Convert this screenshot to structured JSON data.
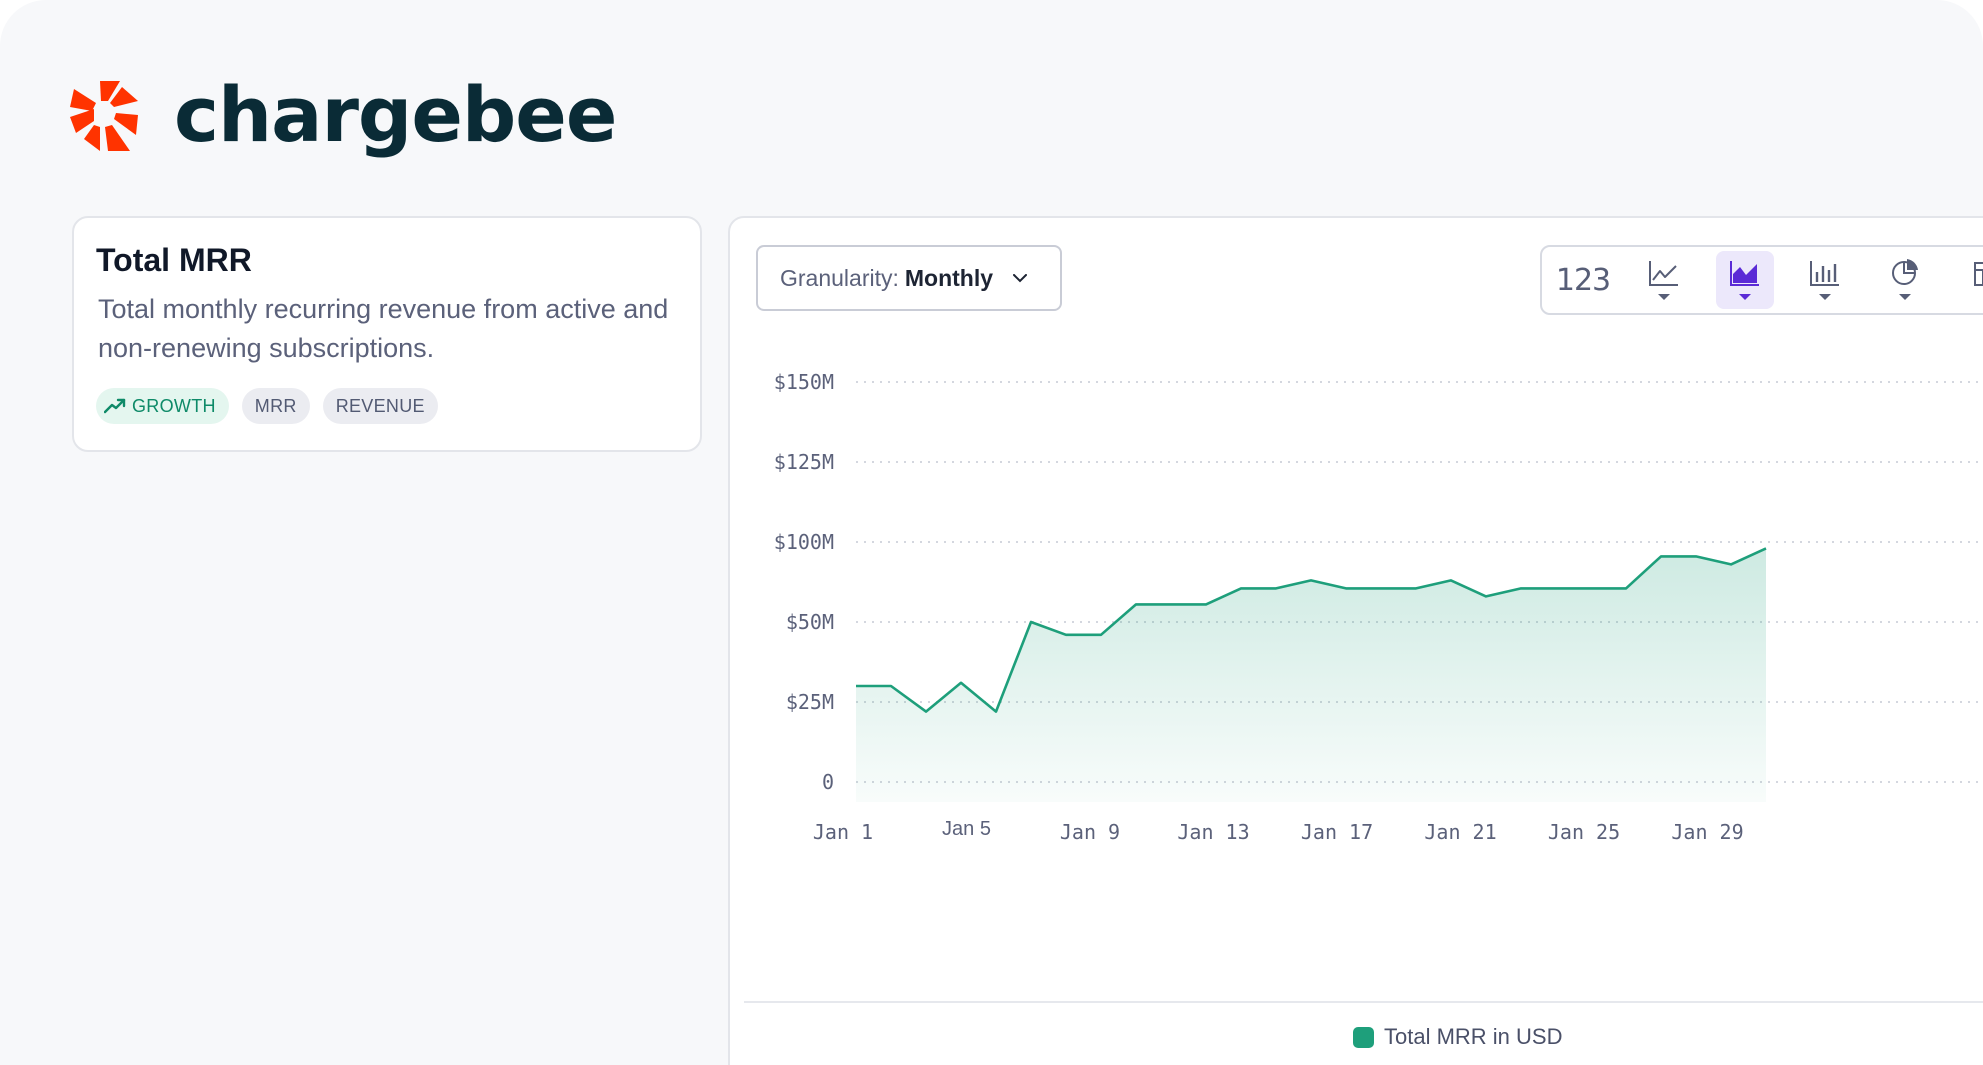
{
  "brand": {
    "name": "chargebee",
    "logo_color": "#ff3300",
    "text_color": "#0a2b36"
  },
  "metric_card": {
    "title": "Total MRR",
    "description": "Total monthly recurring revenue from active and non-renewing subscriptions.",
    "tags": [
      {
        "label": "GROWTH",
        "icon": "trend-up-icon"
      },
      {
        "label": "MRR"
      },
      {
        "label": "REVENUE"
      }
    ]
  },
  "controls": {
    "granularity_label": "Granularity:",
    "granularity_value": "Monthly",
    "toolbar": [
      {
        "name": "number-view",
        "label": "123"
      },
      {
        "name": "line-chart",
        "icon": "line-chart-icon"
      },
      {
        "name": "area-chart",
        "icon": "area-chart-icon",
        "active": true
      },
      {
        "name": "bar-chart",
        "icon": "bar-chart-icon"
      },
      {
        "name": "pie-chart",
        "icon": "pie-chart-icon"
      },
      {
        "name": "table-view",
        "icon": "table-icon"
      }
    ]
  },
  "chart_data": {
    "type": "area",
    "title": "",
    "xlabel": "",
    "ylabel": "",
    "y_ticks": [
      "$150M",
      "$125M",
      "$100M",
      "$50M",
      "$25M",
      "0"
    ],
    "x_ticks": [
      "Jan 1",
      "Jan 5",
      "Jan 9",
      "Jan 13",
      "Jan 17",
      "Jan 21",
      "Jan 25",
      "Jan 29"
    ],
    "series": [
      {
        "name": "Total MRR in USD",
        "color": "#1e9f7b",
        "values": [
          30,
          30,
          22,
          31,
          22,
          50,
          46,
          46,
          61,
          61,
          61,
          71,
          71,
          76,
          71,
          71,
          71,
          76,
          66,
          71,
          71,
          71,
          71,
          91,
          91,
          86,
          96
        ]
      }
    ],
    "grid": true,
    "legend": "bottom-center"
  }
}
